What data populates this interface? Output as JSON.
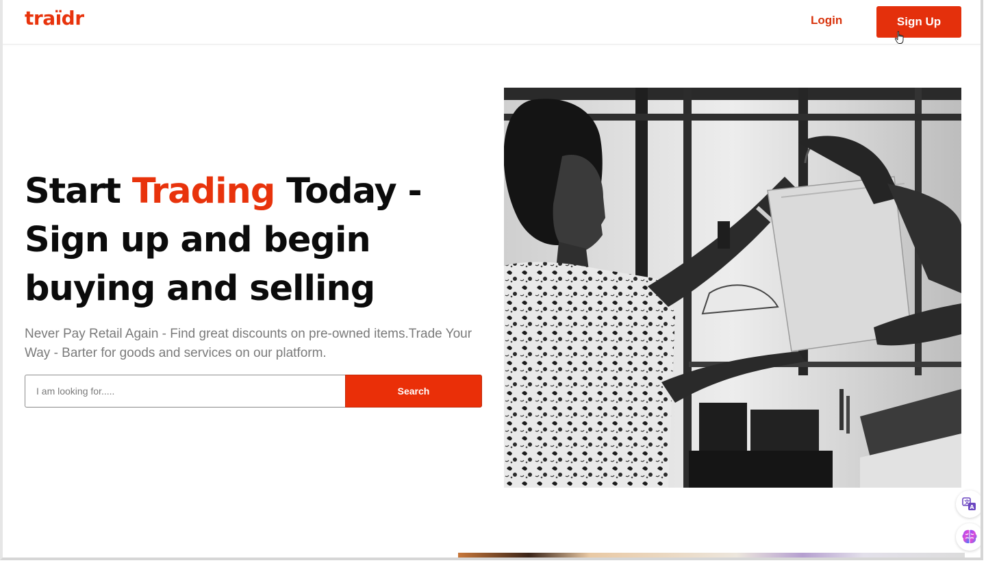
{
  "header": {
    "logo_text": "traïdr",
    "login_label": "Login",
    "signup_label": "Sign Up"
  },
  "hero": {
    "title_part1": "Start ",
    "title_accent": "Trading",
    "title_part2": " Today - Sign up and begin buying and selling",
    "subtitle": "Never Pay Retail Again - Find great discounts on pre-owned items.Trade Your Way - Barter for goods and services on our platform.",
    "search_placeholder": "I am looking for.....",
    "search_value": "",
    "search_button_label": "Search"
  },
  "colors": {
    "brand": "#e8330c",
    "text_dark": "#0b0b0b",
    "text_muted": "#7a7a7a"
  },
  "icons": {
    "cursor": "hand-pointer-icon",
    "translate": "translate-icon",
    "assistant": "brain-icon"
  }
}
